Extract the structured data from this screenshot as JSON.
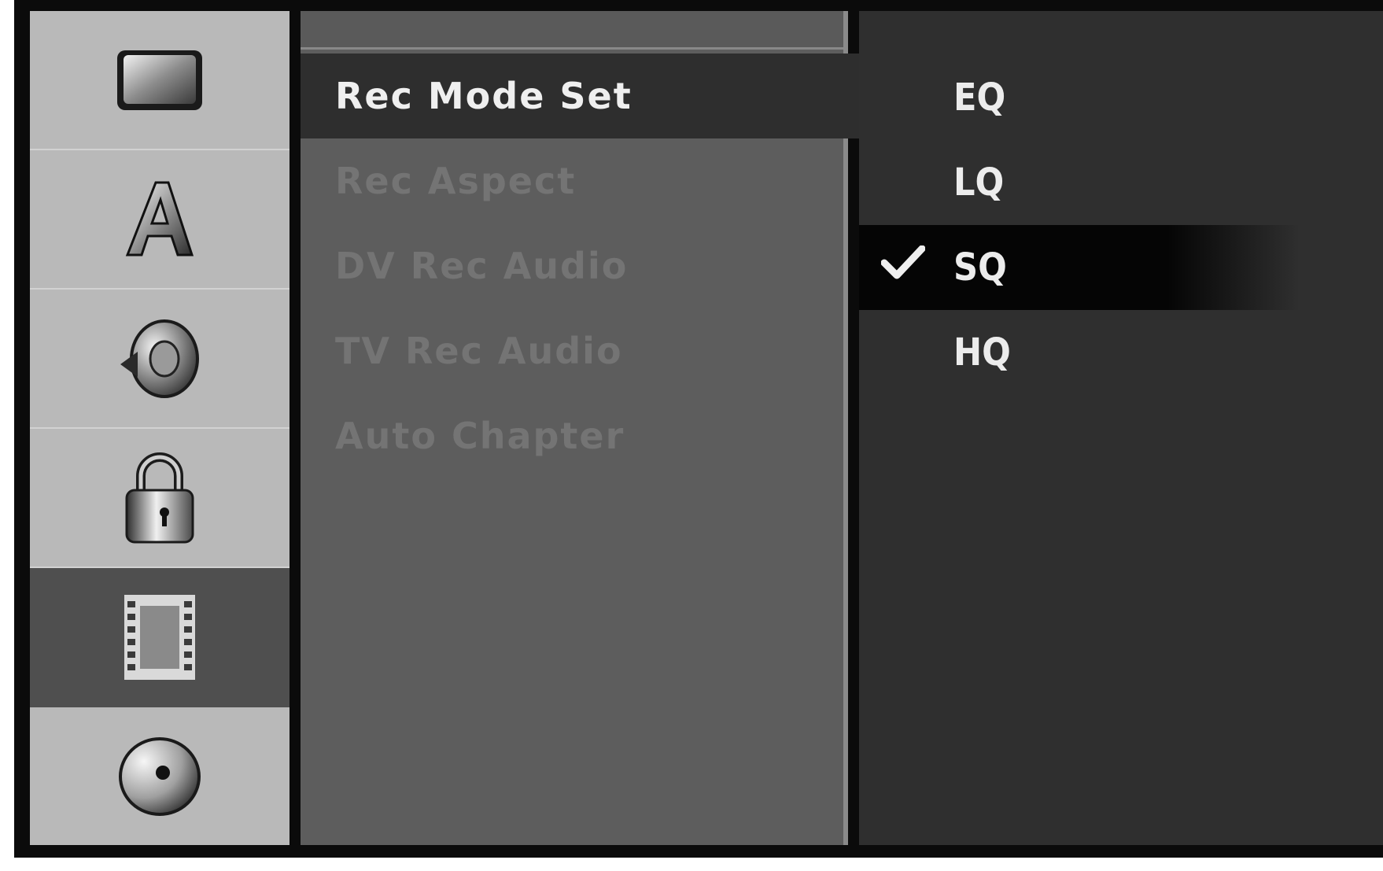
{
  "sidebar": {
    "items": [
      {
        "icon": "tv-screen-icon",
        "selected": false
      },
      {
        "icon": "language-a-icon",
        "selected": false
      },
      {
        "icon": "speaker-icon",
        "selected": false
      },
      {
        "icon": "padlock-icon",
        "selected": false
      },
      {
        "icon": "film-strip-icon",
        "selected": true
      },
      {
        "icon": "disc-icon",
        "selected": false
      }
    ]
  },
  "menu": {
    "items": [
      {
        "label": "Rec Mode Set",
        "active": true
      },
      {
        "label": "Rec Aspect",
        "active": false
      },
      {
        "label": "DV Rec Audio",
        "active": false
      },
      {
        "label": "TV Rec Audio",
        "active": false
      },
      {
        "label": "Auto Chapter",
        "active": false
      }
    ]
  },
  "options": {
    "items": [
      {
        "label": "EQ",
        "selected": false
      },
      {
        "label": "LQ",
        "selected": false
      },
      {
        "label": "SQ",
        "selected": true
      },
      {
        "label": "HQ",
        "selected": false
      }
    ],
    "check_icon": "checkmark-icon"
  },
  "colors": {
    "sidebar_bg": "#b9b9b9",
    "sidebar_selected": "#4f4f4f",
    "menu_bg": "#5d5d5d",
    "menu_active_bg": "#2e2e2e",
    "options_bg": "#2f2f2f",
    "option_selected_bg": "#050505",
    "text_active": "#efefef",
    "text_inactive": "#747474"
  }
}
